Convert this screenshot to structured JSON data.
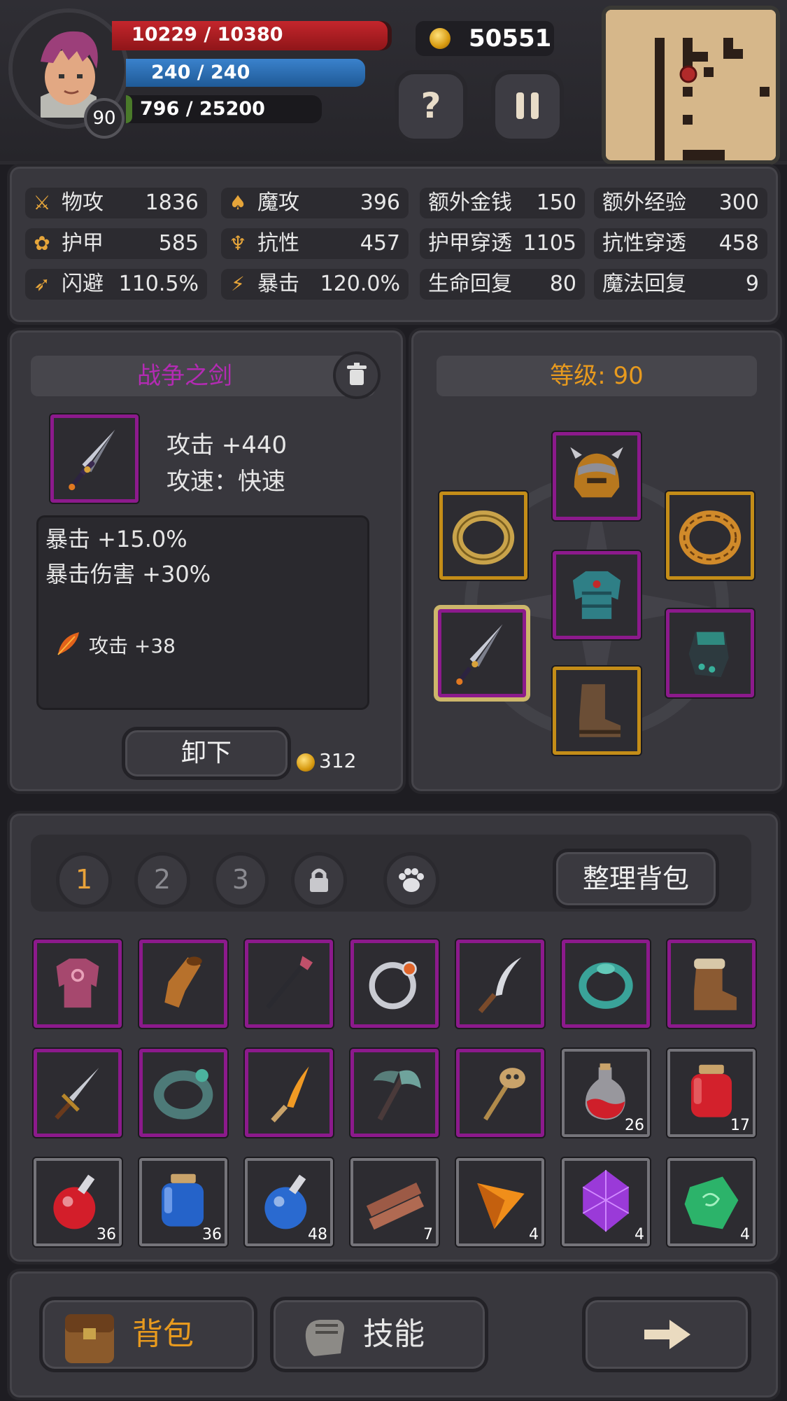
{
  "hud": {
    "level": "90",
    "hp": "10229 / 10380",
    "mp": "240 / 240",
    "xp": "796 / 25200",
    "hp_fraction": 0.985,
    "mp_fraction": 1.0,
    "xp_fraction": 0.032,
    "gold": "50551",
    "help_label": "?",
    "colors": {
      "hp": "#b21e24",
      "mp": "#2e6fb8",
      "gold": "#e3a51c"
    }
  },
  "stats": [
    {
      "icon": "sword-icon",
      "label": "物攻",
      "value": "1836"
    },
    {
      "icon": "magic-hat-icon",
      "label": "魔攻",
      "value": "396"
    },
    {
      "label": "额外金钱",
      "value": "150"
    },
    {
      "label": "额外经验",
      "value": "300"
    },
    {
      "icon": "paw-icon",
      "label": "护甲",
      "value": "585"
    },
    {
      "icon": "strength-icon",
      "label": "抗性",
      "value": "457"
    },
    {
      "label": "护甲穿透",
      "value": "1105"
    },
    {
      "label": "抗性穿透",
      "value": "458"
    },
    {
      "icon": "running-icon",
      "label": "闪避",
      "value": "110.5%"
    },
    {
      "icon": "lightning-icon",
      "label": "暴击",
      "value": "120.0%"
    },
    {
      "label": "生命回复",
      "value": "80"
    },
    {
      "label": "魔法回复",
      "value": "9"
    }
  ],
  "item_detail": {
    "name": "战争之剑",
    "name_color": "#b32bb3",
    "attack": "攻击 +440",
    "speed": "攻速：快速",
    "bonus1": "暴击 +15.0%",
    "bonus2": "暴击伤害 +30%",
    "enchant": "攻击 +38",
    "unequip_label": "卸下",
    "sell_price": "312"
  },
  "equipment": {
    "level_label": "等级: 90",
    "level_color": "#e89a1e"
  },
  "inventory": {
    "tabs": [
      "1",
      "2",
      "3"
    ],
    "sort_label": "整理背包",
    "rows": [
      [
        {
          "icon": "chest-armor-icon",
          "rarity": "purple"
        },
        {
          "icon": "gauntlet-icon",
          "rarity": "purple"
        },
        {
          "icon": "staff-icon",
          "rarity": "purple"
        },
        {
          "icon": "silver-ring-icon",
          "rarity": "purple"
        },
        {
          "icon": "curved-dagger-icon",
          "rarity": "purple"
        },
        {
          "icon": "jade-ring-icon",
          "rarity": "purple"
        },
        {
          "icon": "fur-boots-icon",
          "rarity": "purple"
        }
      ],
      [
        {
          "icon": "short-sword-icon",
          "rarity": "purple"
        },
        {
          "icon": "stone-ring-icon",
          "rarity": "purple"
        },
        {
          "icon": "flame-dagger-icon",
          "rarity": "purple"
        },
        {
          "icon": "axe-icon",
          "rarity": "purple"
        },
        {
          "icon": "skull-staff-icon",
          "rarity": "purple"
        },
        {
          "icon": "red-potion-icon",
          "rarity": "gray",
          "count": "26"
        },
        {
          "icon": "red-jar-icon",
          "rarity": "gray",
          "count": "17"
        }
      ],
      [
        {
          "icon": "red-flask-icon",
          "rarity": "gray",
          "count": "36"
        },
        {
          "icon": "blue-jar-icon",
          "rarity": "gray",
          "count": "36"
        },
        {
          "icon": "blue-flask-icon",
          "rarity": "gray",
          "count": "48"
        },
        {
          "icon": "wood-planks-icon",
          "rarity": "gray",
          "count": "7"
        },
        {
          "icon": "orange-gem-icon",
          "rarity": "gray",
          "count": "4"
        },
        {
          "icon": "purple-gem-icon",
          "rarity": "gray",
          "count": "4"
        },
        {
          "icon": "green-stone-icon",
          "rarity": "gray",
          "count": "4"
        }
      ]
    ]
  },
  "bottom_nav": {
    "bag_label": "背包",
    "skills_label": "技能"
  }
}
